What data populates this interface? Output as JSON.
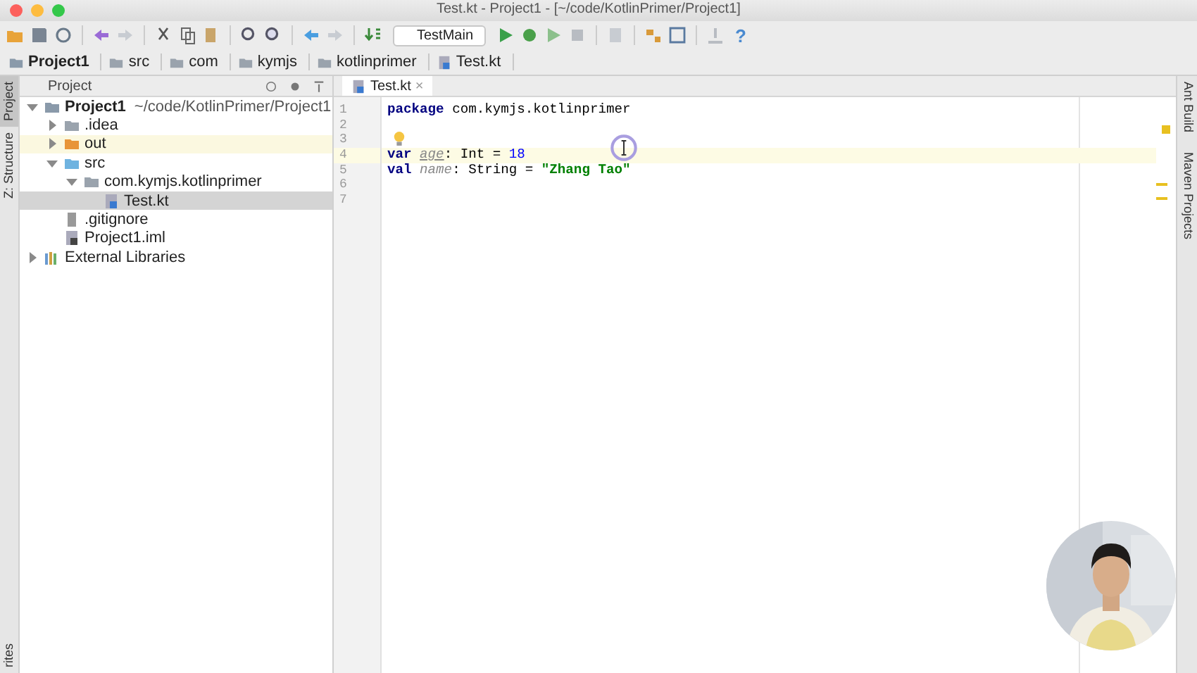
{
  "window": {
    "title": "Test.kt - Project1 - [~/code/KotlinPrimer/Project1]"
  },
  "toolbar": {
    "run_config": "TestMain",
    "help_glyph": "?"
  },
  "breadcrumbs": [
    {
      "label": "Project1",
      "bold": true,
      "kind": "project"
    },
    {
      "label": "src",
      "bold": false,
      "kind": "folder"
    },
    {
      "label": "com",
      "bold": false,
      "kind": "folder"
    },
    {
      "label": "kymjs",
      "bold": false,
      "kind": "folder"
    },
    {
      "label": "kotlinprimer",
      "bold": false,
      "kind": "folder"
    },
    {
      "label": "Test.kt",
      "bold": false,
      "kind": "kotlin"
    }
  ],
  "left_tool_strip": [
    {
      "label": "Project",
      "selected": true
    },
    {
      "label": "Z: Structure",
      "selected": false
    },
    {
      "label": "rites",
      "selected": false
    }
  ],
  "right_tool_strip": [
    {
      "label": "Ant Build"
    },
    {
      "label": "Maven Projects"
    }
  ],
  "project_panel": {
    "header": "Project",
    "tree": [
      {
        "label": "Project1",
        "detail": "~/code/KotlinPrimer/Project1",
        "kind": "project",
        "expanded": true,
        "selected": false,
        "highlighted": false,
        "children": [
          {
            "label": ".idea",
            "kind": "folder",
            "color": "#9aa3ad",
            "expanded": false,
            "selected": false,
            "highlighted": false
          },
          {
            "label": "out",
            "kind": "folder",
            "color": "#e8953a",
            "expanded": false,
            "selected": false,
            "highlighted": true
          },
          {
            "label": "src",
            "kind": "folder",
            "color": "#6fb3e0",
            "expanded": true,
            "selected": false,
            "highlighted": false,
            "children": [
              {
                "label": "com.kymjs.kotlinprimer",
                "kind": "folder",
                "color": "#9aa3ad",
                "expanded": true,
                "selected": false,
                "highlighted": false,
                "children": [
                  {
                    "label": "Test.kt",
                    "kind": "kotlin",
                    "selected": true,
                    "highlighted": false
                  }
                ]
              }
            ]
          },
          {
            "label": ".gitignore",
            "kind": "file",
            "selected": false,
            "highlighted": false
          },
          {
            "label": "Project1.iml",
            "kind": "module",
            "selected": false,
            "highlighted": false
          }
        ]
      },
      {
        "label": "External Libraries",
        "kind": "library",
        "expanded": false,
        "selected": false,
        "highlighted": false
      }
    ]
  },
  "editor": {
    "tabs": [
      {
        "label": "Test.kt",
        "close": "×",
        "selected": true
      }
    ],
    "lines": [
      {
        "number": "1",
        "current": false,
        "bulb": false,
        "tokens": [
          {
            "kind": "keyword",
            "text": "package"
          },
          {
            "kind": "plain",
            "text": " com.kymjs.kotlinprimer"
          }
        ]
      },
      {
        "number": "2",
        "current": false,
        "bulb": false
      },
      {
        "number": "3",
        "current": false,
        "bulb": true
      },
      {
        "number": "4",
        "current": true,
        "bulb": false,
        "tokens": [
          {
            "kind": "keyword",
            "text": "var "
          },
          {
            "kind": "var",
            "text": "age"
          },
          {
            "kind": "plain",
            "text": ": Int = "
          },
          {
            "kind": "number",
            "text": "18"
          }
        ]
      },
      {
        "number": "5",
        "current": false,
        "bulb": false,
        "tokens": [
          {
            "kind": "keyword",
            "text": "val "
          },
          {
            "kind": "val",
            "text": "name"
          },
          {
            "kind": "plain",
            "text": ": String = "
          },
          {
            "kind": "string",
            "text": "\"Zhang Tao\""
          }
        ]
      },
      {
        "number": "6",
        "current": false,
        "bulb": false
      },
      {
        "number": "7",
        "current": false,
        "bulb": false
      }
    ]
  }
}
